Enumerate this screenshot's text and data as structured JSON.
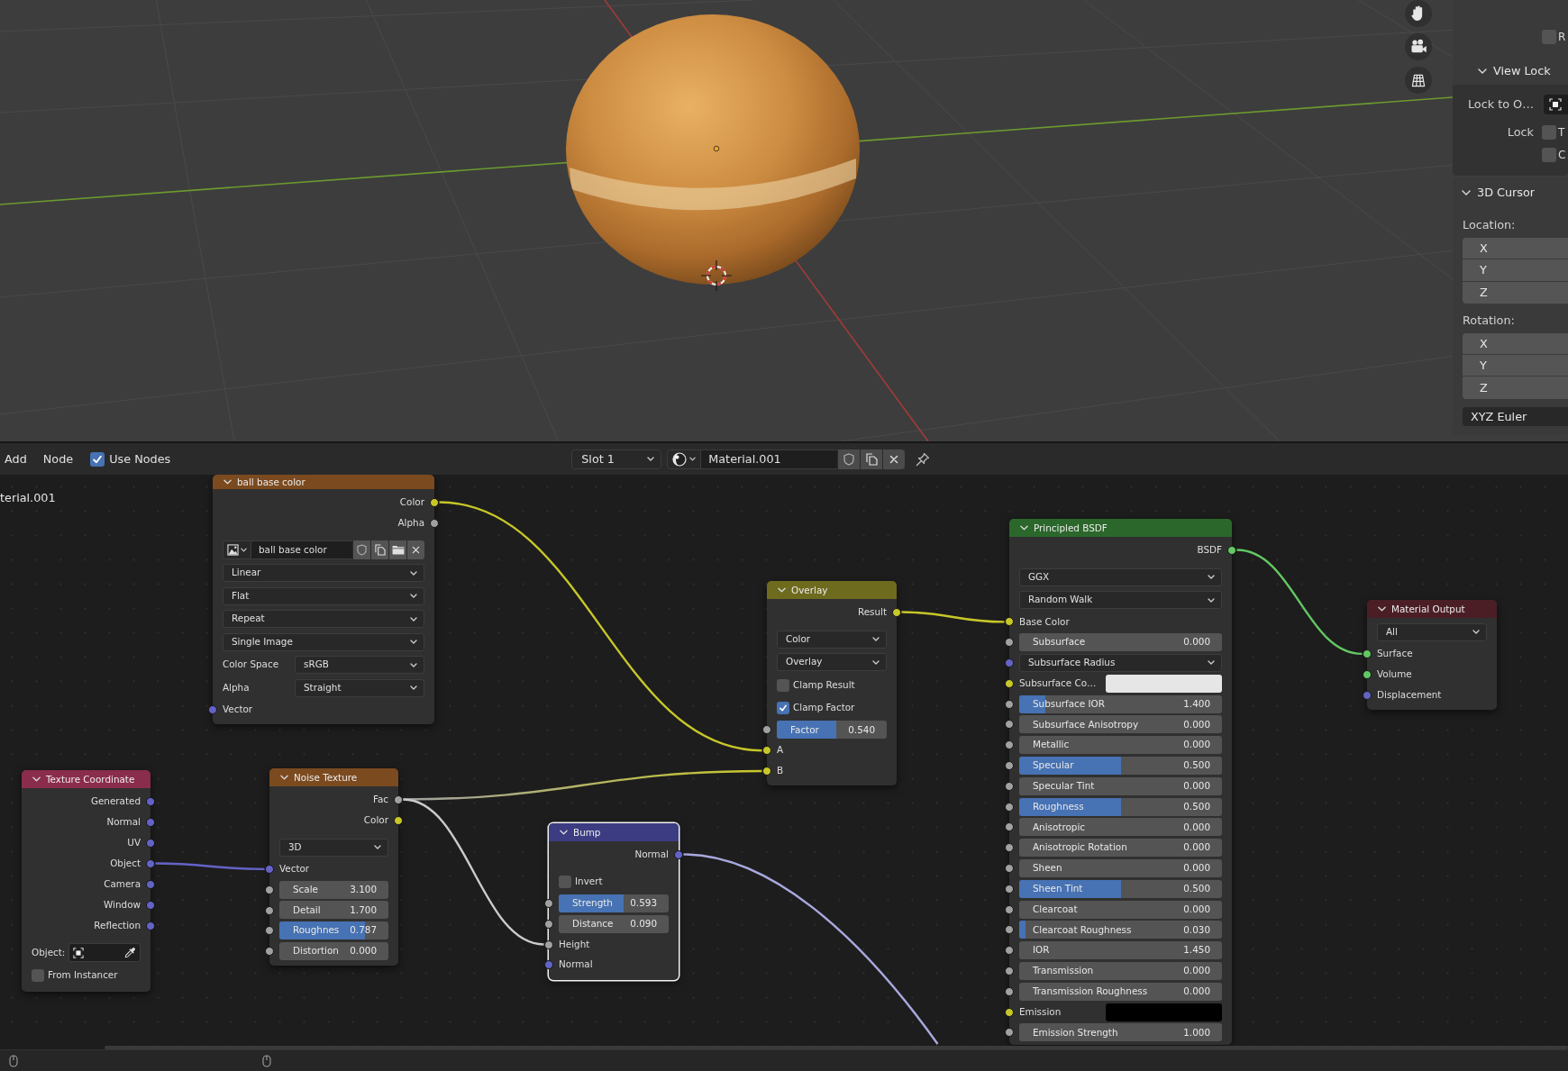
{
  "sidebar": {
    "render_region": {
      "label": "R",
      "checked": false
    },
    "panels": [
      {
        "title": "View Lock",
        "rows": [
          {
            "kind": "object",
            "label": "Lock to O…"
          },
          {
            "kind": "checkbox",
            "label": "Lock",
            "text": "T",
            "checked": false
          },
          {
            "kind": "checkbox",
            "text": "C",
            "checked": false
          }
        ]
      },
      {
        "title": "3D Cursor",
        "rows": [
          {
            "kind": "heading",
            "label": "Location:"
          },
          {
            "kind": "vector",
            "fields": [
              "X",
              "Y",
              "Z"
            ]
          },
          {
            "kind": "heading",
            "label": "Rotation:"
          },
          {
            "kind": "vector",
            "fields": [
              "X",
              "Y",
              "Z"
            ]
          },
          {
            "kind": "dropdown",
            "value": "XYZ Euler"
          }
        ]
      }
    ]
  },
  "node_editor": {
    "header": {
      "menus": [
        "Add",
        "Node"
      ],
      "use_nodes": {
        "label": "Use Nodes",
        "checked": true
      },
      "slot": "Slot 1",
      "material": "Material.001"
    },
    "breadcrumb": "terial.001",
    "nodes": [
      {
        "title": "ball base color",
        "color": "#7b4a1f",
        "selected": false,
        "rows": [
          {
            "kind": "output",
            "label": "Color",
            "socket": {
              "color": "#c7c729"
            }
          },
          {
            "kind": "output",
            "label": "Alpha",
            "socket": {
              "color": "#a1a1a1"
            }
          },
          {
            "kind": "image",
            "value": "ball base color"
          },
          {
            "kind": "dropdown",
            "value": "Linear"
          },
          {
            "kind": "dropdown",
            "value": "Flat"
          },
          {
            "kind": "dropdown",
            "value": "Repeat"
          },
          {
            "kind": "dropdown",
            "value": "Single Image"
          },
          {
            "kind": "select",
            "label": "Color Space",
            "value": "sRGB"
          },
          {
            "kind": "select",
            "label": "Alpha",
            "value": "Straight"
          },
          {
            "kind": "input",
            "label": "Vector",
            "socket": {
              "color": "#6363c7"
            }
          }
        ]
      },
      {
        "title": "Overlay",
        "color": "#6e6a1e",
        "selected": false,
        "rows": [
          {
            "kind": "output",
            "label": "Result",
            "socket": {
              "color": "#c7c729"
            }
          },
          {
            "kind": "dropdown",
            "value": "Color"
          },
          {
            "kind": "dropdown",
            "value": "Overlay"
          },
          {
            "kind": "checkbox",
            "label": "Clamp Result",
            "checked": false
          },
          {
            "kind": "checkbox",
            "label": "Clamp Factor",
            "checked": true
          },
          {
            "kind": "slider",
            "label": "Factor",
            "value": "0.540",
            "level": 0.54,
            "socket": {
              "color": "#a1a1a1"
            }
          },
          {
            "kind": "input",
            "label": "A",
            "socket": {
              "color": "#c7c729"
            }
          },
          {
            "kind": "input",
            "label": "B",
            "socket": {
              "color": "#c7c729"
            }
          }
        ]
      },
      {
        "title": "Principled BSDF",
        "color": "#2b672b",
        "selected": false,
        "rows": [
          {
            "kind": "output",
            "label": "BSDF",
            "socket": {
              "color": "#63c763"
            }
          },
          {
            "kind": "dropdown",
            "value": "GGX"
          },
          {
            "kind": "dropdown",
            "value": "Random Walk"
          },
          {
            "kind": "input",
            "label": "Base Color",
            "socket": {
              "color": "#c7c729"
            }
          },
          {
            "kind": "slider",
            "label": "Subsurface",
            "value": "0.000",
            "level": 0,
            "socket": {
              "color": "#a1a1a1"
            }
          },
          {
            "kind": "dropdown",
            "value": "Subsurface Radius",
            "socket": {
              "color": "#6363c7"
            }
          },
          {
            "kind": "color",
            "label": "Subsurface Co…",
            "swatch": {
              "color": "#e6e6e6"
            },
            "socket": {
              "color": "#c7c729"
            }
          },
          {
            "kind": "slider",
            "label": "Subsurface IOR",
            "value": "1.400",
            "level": 0.13,
            "socket": {
              "color": "#a1a1a1"
            }
          },
          {
            "kind": "slider",
            "label": "Subsurface Anisotropy",
            "value": "0.000",
            "level": 0,
            "socket": {
              "color": "#a1a1a1"
            }
          },
          {
            "kind": "slider",
            "label": "Metallic",
            "value": "0.000",
            "level": 0,
            "socket": {
              "color": "#a1a1a1"
            }
          },
          {
            "kind": "slider",
            "label": "Specular",
            "value": "0.500",
            "level": 0.5,
            "socket": {
              "color": "#a1a1a1"
            }
          },
          {
            "kind": "slider",
            "label": "Specular Tint",
            "value": "0.000",
            "level": 0,
            "socket": {
              "color": "#a1a1a1"
            }
          },
          {
            "kind": "slider",
            "label": "Roughness",
            "value": "0.500",
            "level": 0.5,
            "socket": {
              "color": "#a1a1a1"
            }
          },
          {
            "kind": "slider",
            "label": "Anisotropic",
            "value": "0.000",
            "level": 0,
            "socket": {
              "color": "#a1a1a1"
            }
          },
          {
            "kind": "slider",
            "label": "Anisotropic Rotation",
            "value": "0.000",
            "level": 0,
            "socket": {
              "color": "#a1a1a1"
            }
          },
          {
            "kind": "slider",
            "label": "Sheen",
            "value": "0.000",
            "level": 0,
            "socket": {
              "color": "#a1a1a1"
            }
          },
          {
            "kind": "slider",
            "label": "Sheen Tint",
            "value": "0.500",
            "level": 0.5,
            "socket": {
              "color": "#a1a1a1"
            }
          },
          {
            "kind": "slider",
            "label": "Clearcoat",
            "value": "0.000",
            "level": 0,
            "socket": {
              "color": "#a1a1a1"
            }
          },
          {
            "kind": "slider",
            "label": "Clearcoat Roughness",
            "value": "0.030",
            "level": 0.03,
            "socket": {
              "color": "#a1a1a1"
            }
          },
          {
            "kind": "slider",
            "label": "IOR",
            "value": "1.450",
            "level": 0,
            "socket": {
              "color": "#a1a1a1"
            }
          },
          {
            "kind": "slider",
            "label": "Transmission",
            "value": "0.000",
            "level": 0,
            "socket": {
              "color": "#a1a1a1"
            }
          },
          {
            "kind": "slider",
            "label": "Transmission Roughness",
            "value": "0.000",
            "level": 0,
            "socket": {
              "color": "#a1a1a1"
            }
          },
          {
            "kind": "color",
            "label": "Emission",
            "swatch": {
              "color": "#000000"
            },
            "socket": {
              "color": "#c7c729"
            }
          },
          {
            "kind": "slider",
            "label": "Emission Strength",
            "value": "1.000",
            "level": 0,
            "socket": {
              "color": "#a1a1a1"
            }
          }
        ]
      },
      {
        "title": "Material Output",
        "color": "#4b1e26",
        "selected": false,
        "rows": [
          {
            "kind": "dropdown",
            "value": "All"
          },
          {
            "kind": "input",
            "label": "Surface",
            "socket": {
              "color": "#63c763"
            }
          },
          {
            "kind": "input",
            "label": "Volume",
            "socket": {
              "color": "#63c763"
            }
          },
          {
            "kind": "input",
            "label": "Displacement",
            "socket": {
              "color": "#6363c7"
            }
          }
        ]
      },
      {
        "title": "Texture Coordinate",
        "color": "#8a2c4b",
        "selected": false,
        "rows": [
          {
            "kind": "output",
            "label": "Generated",
            "socket": {
              "color": "#6363c7"
            }
          },
          {
            "kind": "output",
            "label": "Normal",
            "socket": {
              "color": "#6363c7"
            }
          },
          {
            "kind": "output",
            "label": "UV",
            "socket": {
              "color": "#6363c7"
            }
          },
          {
            "kind": "output",
            "label": "Object",
            "socket": {
              "color": "#6363c7"
            }
          },
          {
            "kind": "output",
            "label": "Camera",
            "socket": {
              "color": "#6363c7"
            }
          },
          {
            "kind": "output",
            "label": "Window",
            "socket": {
              "color": "#6363c7"
            }
          },
          {
            "kind": "output",
            "label": "Reflection",
            "socket": {
              "color": "#6363c7"
            }
          },
          {
            "kind": "object",
            "label": "Object:"
          },
          {
            "kind": "checkbox",
            "label": "From Instancer",
            "checked": false
          }
        ]
      },
      {
        "title": "Noise Texture",
        "color": "#7b4a1f",
        "selected": false,
        "rows": [
          {
            "kind": "output",
            "label": "Fac",
            "socket": {
              "color": "#a1a1a1"
            }
          },
          {
            "kind": "output",
            "label": "Color",
            "socket": {
              "color": "#c7c729"
            }
          },
          {
            "kind": "dropdown",
            "value": "3D"
          },
          {
            "kind": "input",
            "label": "Vector",
            "socket": {
              "color": "#6363c7"
            }
          },
          {
            "kind": "slider",
            "label": "Scale",
            "value": "3.100",
            "level": 0,
            "socket": {
              "color": "#a1a1a1"
            }
          },
          {
            "kind": "slider",
            "label": "Detail",
            "value": "1.700",
            "level": 0,
            "socket": {
              "color": "#a1a1a1"
            }
          },
          {
            "kind": "slider",
            "label": "Roughnes",
            "value": "0.787",
            "level": 0.787,
            "socket": {
              "color": "#a1a1a1"
            }
          },
          {
            "kind": "slider",
            "label": "Distortion",
            "value": "0.000",
            "level": 0,
            "socket": {
              "color": "#a1a1a1"
            }
          }
        ]
      },
      {
        "title": "Bump",
        "color": "#3c3c83",
        "selected": true,
        "rows": [
          {
            "kind": "output",
            "label": "Normal",
            "socket": {
              "color": "#6363c7"
            }
          },
          {
            "kind": "checkbox",
            "label": "Invert",
            "checked": false
          },
          {
            "kind": "slider",
            "label": "Strength",
            "value": "0.593",
            "level": 0.593,
            "socket": {
              "color": "#a1a1a1"
            }
          },
          {
            "kind": "slider",
            "label": "Distance",
            "value": "0.090",
            "level": 0,
            "socket": {
              "color": "#a1a1a1"
            }
          },
          {
            "kind": "input",
            "label": "Height",
            "socket": {
              "color": "#a1a1a1"
            }
          },
          {
            "kind": "input",
            "label": "Normal",
            "socket": {
              "color": "#6363c7"
            }
          }
        ]
      }
    ]
  }
}
